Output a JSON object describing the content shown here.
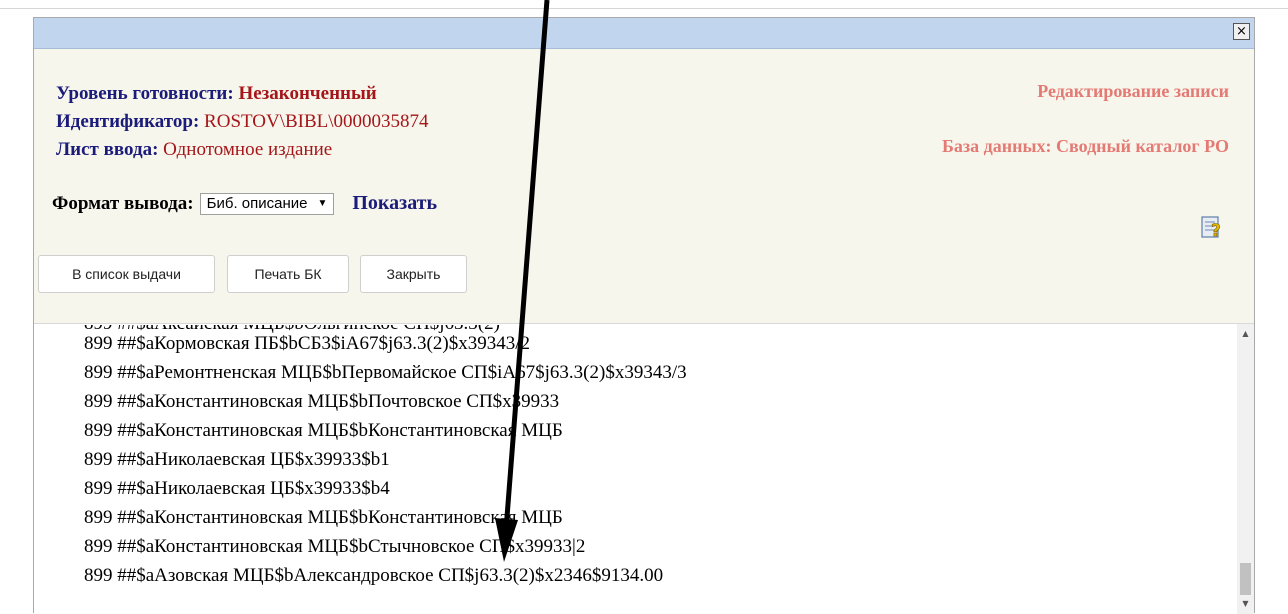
{
  "background": {
    "fragments": [
      "С",
      "С",
      "Ф",
      "П",
      "Б",
      "Б",
      "Н",
      "С"
    ]
  },
  "dialog": {
    "close_label": "×",
    "readiness_label": "Уровень готовности:",
    "readiness_value": "Незаконченный",
    "identifier_label": "Идентификатор:",
    "identifier_value": "ROSTOV\\BIBL\\0000035874",
    "sheet_label": "Лист ввода:",
    "sheet_value": "Однотомное издание",
    "edit_title": "Редактирование записи",
    "database": "База данных: Сводный каталог РО",
    "format_label": "Формат вывода:",
    "format_selected": "Биб. описание",
    "show_link": "Показать",
    "help_icon": "help-icon",
    "buttons": {
      "to_list": "В список выдачи",
      "print_card": "Печать БК",
      "close": "Закрыть"
    }
  },
  "records": [
    "899 ##$aКормовская ПБ$bСБ3$iA67$j63.3(2)$x39343/2",
    "899 ##$aРемонтненская МЦБ$bПервомайское СП$iA67$j63.3(2)$x39343/3",
    "899 ##$aКонстантиновская МЦБ$bПочтовское СП$x39933",
    "899 ##$aКонстантиновская МЦБ$bКонстантиновская МЦБ",
    "899 ##$aНиколаевская ЦБ$x39933$b1",
    "899 ##$aНиколаевская ЦБ$x39933$b4",
    "899 ##$aКонстантиновская МЦБ$bКонстантиновская МЦБ",
    "899 ##$aКонстантиновская МЦБ$bСтычновское СП$x39933|2",
    "899 ##$aАзовская МЦБ$bАлександровское СП$j63.3(2)$x2346$9134.00"
  ],
  "colors": {
    "titlebar": "#c1d6ee",
    "dialog_bg": "#f7f6ec",
    "label_navy": "#1b1b7a",
    "value_red": "#a4161a",
    "header_pink": "#e47a74"
  }
}
